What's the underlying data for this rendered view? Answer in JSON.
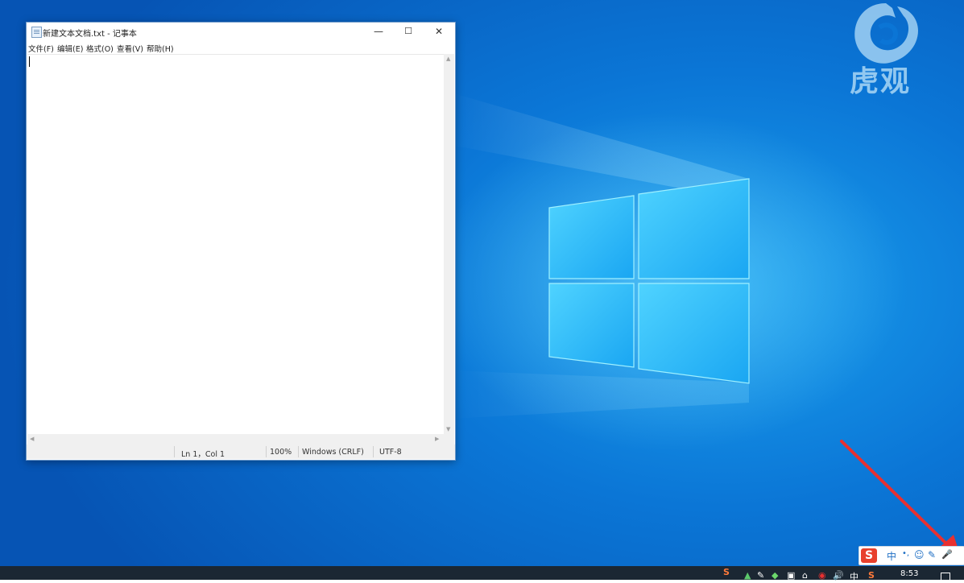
{
  "notepad": {
    "title": "新建文本文档.txt - 记事本",
    "controls": {
      "minimize": "—",
      "maximize": "☐",
      "close": "✕"
    },
    "menu": [
      "文件(F)",
      "编辑(E)",
      "格式(O)",
      "查看(V)",
      "帮助(H)"
    ],
    "content": "",
    "status": {
      "position": "Ln 1，Col 1",
      "zoom": "100%",
      "line_ending": "Windows (CRLF)",
      "encoding": "UTF-8"
    }
  },
  "watermark": {
    "text": "虎观"
  },
  "ime": {
    "logo": "S",
    "items": [
      "中",
      "•,",
      "☺",
      "✎",
      "🎤"
    ]
  },
  "taskbar": {
    "tray_icons": [
      "S",
      "▲",
      "✎",
      "◆",
      "▣",
      "⌂",
      "◉",
      "🔊",
      "中",
      "S"
    ],
    "time": "8:53"
  },
  "colors": {
    "accent_red": "#e8402c",
    "taskbar": "#1b2733",
    "desktop_blue": "#0b76d6"
  }
}
